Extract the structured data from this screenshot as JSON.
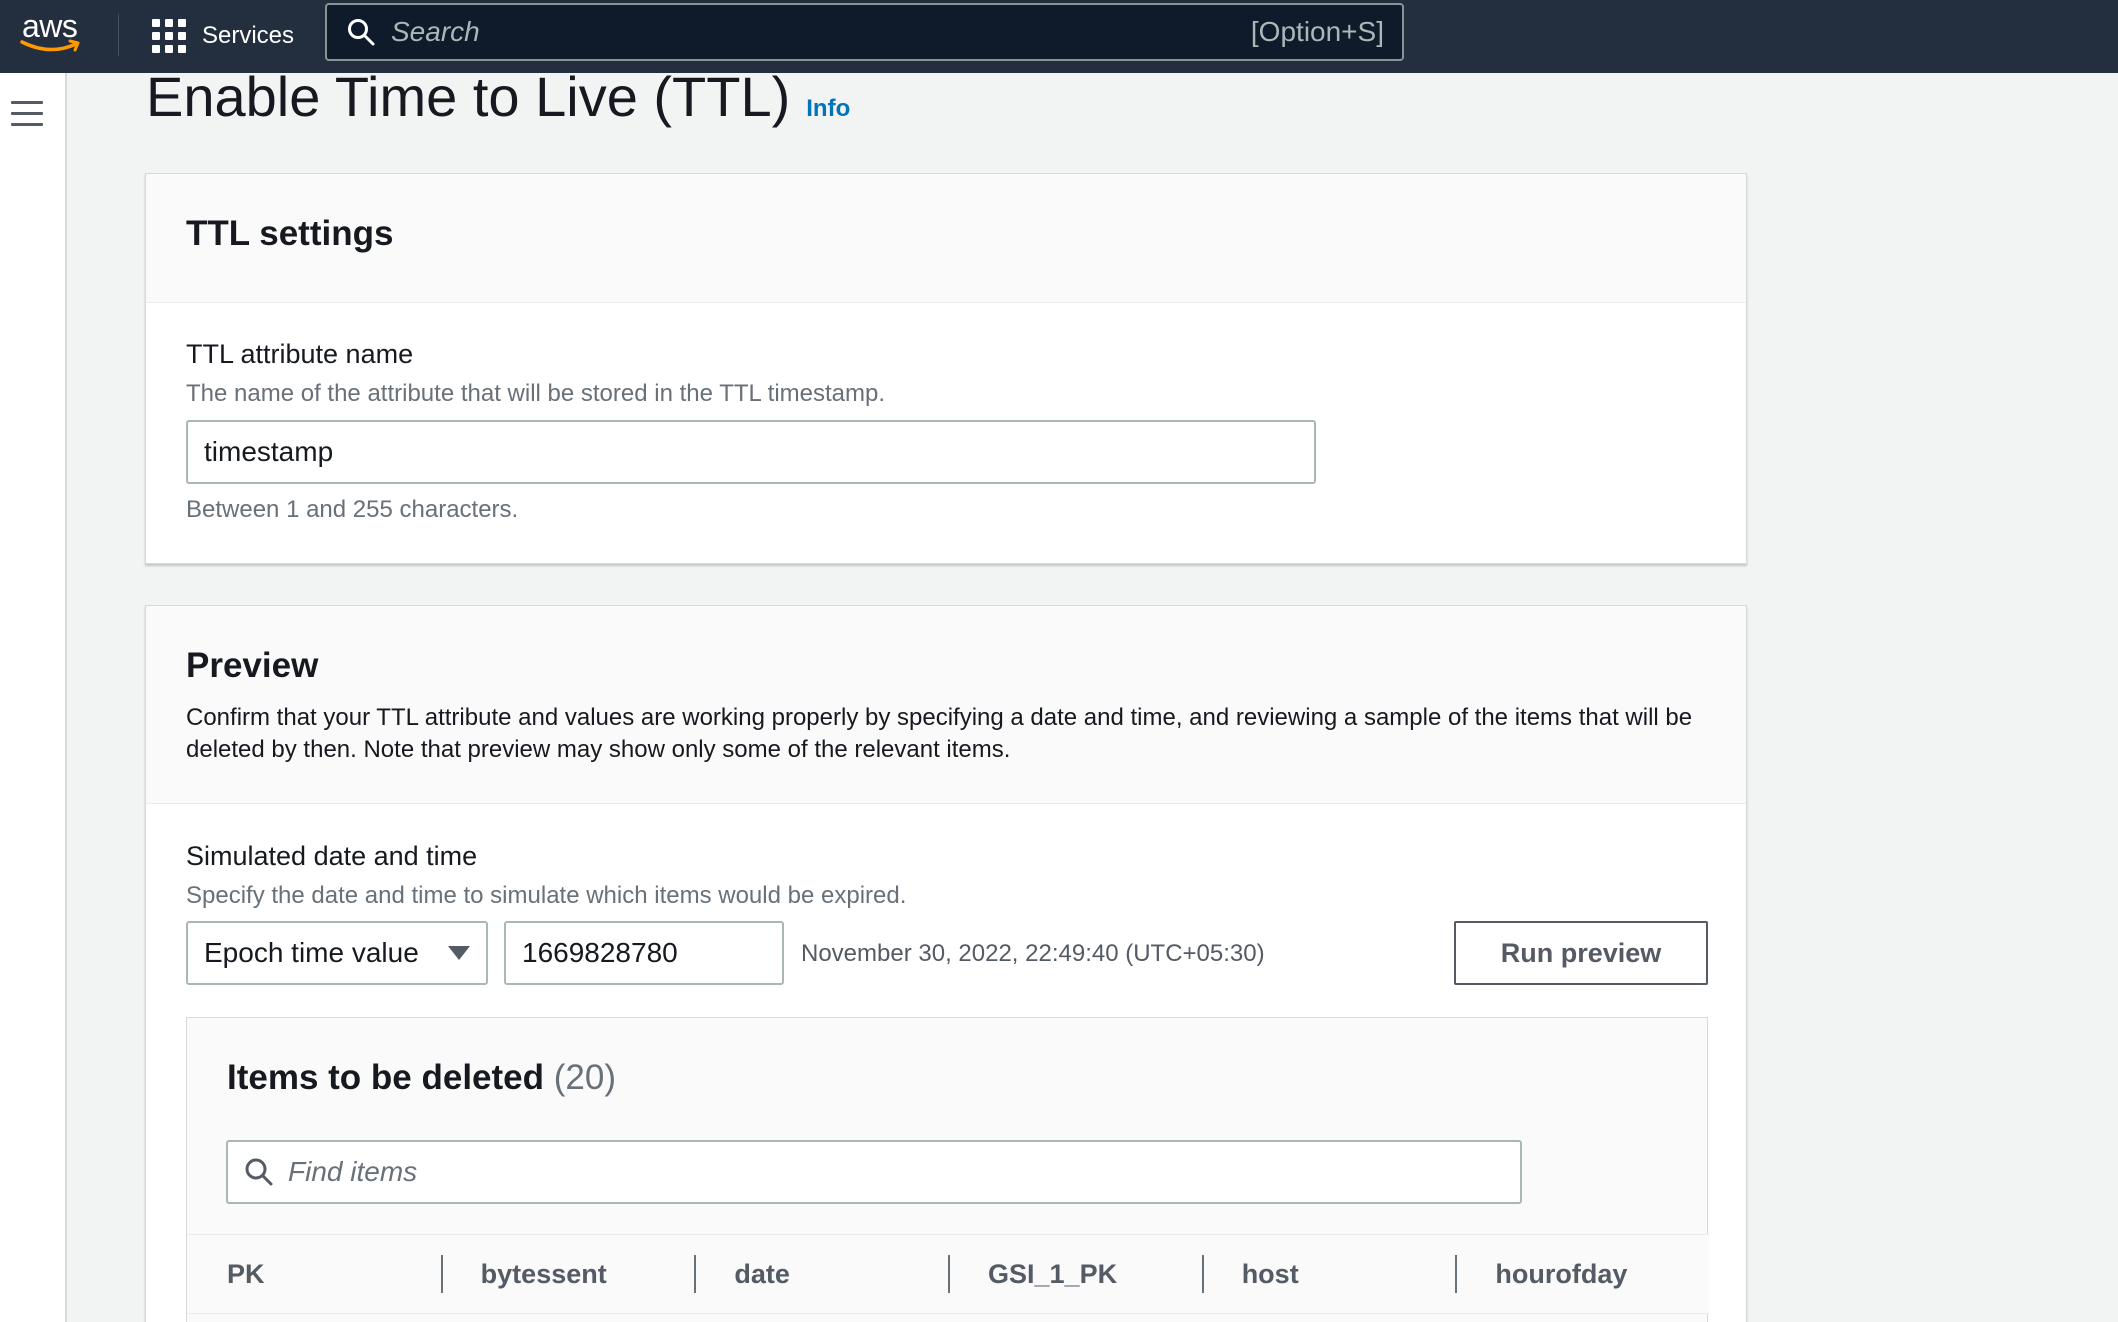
{
  "topbar": {
    "logo_text": "aws",
    "services_label": "Services",
    "search_placeholder": "Search",
    "search_shortcut": "[Option+S]"
  },
  "page": {
    "title": "Enable Time to Live (TTL)",
    "info_label": "Info"
  },
  "ttl_settings": {
    "heading": "TTL settings",
    "field_label": "TTL attribute name",
    "field_description": "The name of the attribute that will be stored in the TTL timestamp.",
    "field_value": "timestamp",
    "field_constraint": "Between 1 and 255 characters."
  },
  "preview": {
    "heading": "Preview",
    "description": "Confirm that your TTL attribute and values are working properly by specifying a date and time, and reviewing a sample of the items that will be deleted by then. Note that preview may show only some of the relevant items.",
    "sim_label": "Simulated date and time",
    "sim_description": "Specify the date and time to simulate which items would be expired.",
    "time_format_selected": "Epoch time value",
    "epoch_value": "1669828780",
    "converted_datetime": "November 30, 2022, 22:49:40 (UTC+05:30)",
    "run_button": "Run preview",
    "items": {
      "title": "Items to be deleted",
      "count": "(20)",
      "find_placeholder": "Find items",
      "columns": [
        "PK",
        "bytessent",
        "date",
        "GSI_1_PK",
        "host",
        "hourofday"
      ]
    }
  },
  "colors": {
    "topbar_bg": "#232f3e",
    "link": "#0073bb",
    "page_bg": "#f2f3f3"
  }
}
